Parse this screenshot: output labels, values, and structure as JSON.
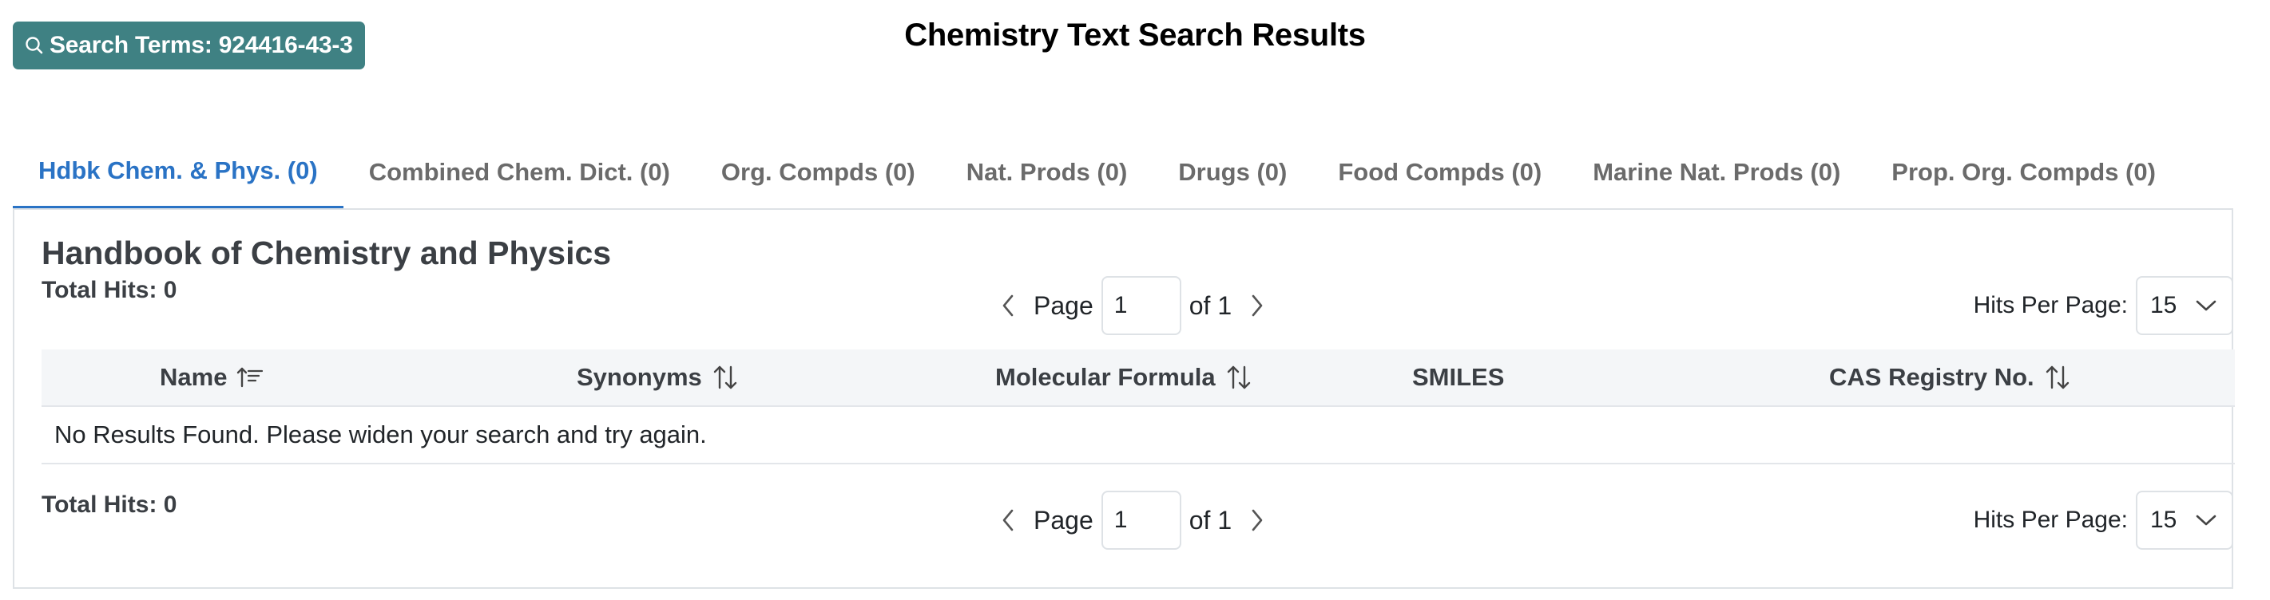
{
  "header": {
    "search_terms_label": "Search Terms: 924416-43-3",
    "title": "Chemistry Text Search Results",
    "search_icon": "search-icon"
  },
  "tabs": [
    {
      "label": "Hdbk Chem. & Phys. (0)",
      "active": true
    },
    {
      "label": "Combined Chem. Dict. (0)",
      "active": false
    },
    {
      "label": "Org. Compds (0)",
      "active": false
    },
    {
      "label": "Nat. Prods (0)",
      "active": false
    },
    {
      "label": "Drugs (0)",
      "active": false
    },
    {
      "label": "Food Compds (0)",
      "active": false
    },
    {
      "label": "Marine Nat. Prods (0)",
      "active": false
    },
    {
      "label": "Prop. Org. Compds (0)",
      "active": false
    }
  ],
  "results": {
    "title": "Handbook of Chemistry and Physics",
    "total_hits_top": "Total Hits: 0",
    "total_hits_bottom": "Total Hits: 0",
    "pager_top": {
      "page_label": "Page",
      "page_value": "1",
      "of_label": "of 1"
    },
    "pager_bottom": {
      "page_label": "Page",
      "page_value": "1",
      "of_label": "of 1"
    },
    "hits_per_page_label": "Hits Per Page:",
    "hits_per_page_value": "15",
    "columns": [
      {
        "label": "Name",
        "sort_icon": "sort-ascending-icon"
      },
      {
        "label": "Synonyms",
        "sort_icon": "sort-both-icon"
      },
      {
        "label": "Molecular Formula",
        "sort_icon": "sort-both-icon"
      },
      {
        "label": "SMILES",
        "sort_icon": ""
      },
      {
        "label": "CAS Registry No.",
        "sort_icon": "sort-both-icon"
      }
    ],
    "empty_message": "No Results Found. Please widen your search and try again."
  },
  "colors": {
    "accent": "#2a73c5",
    "search_button": "#3f8183",
    "tab_inactive": "#6b6b6b",
    "table_header_bg": "#f4f6f8"
  }
}
